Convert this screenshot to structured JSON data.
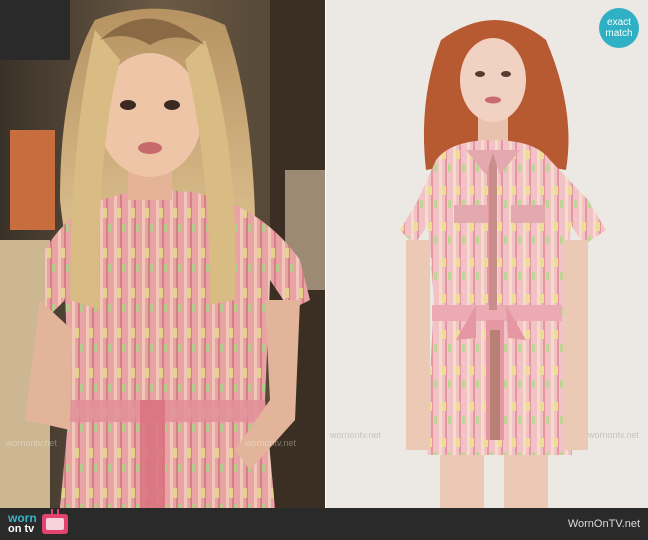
{
  "badge": {
    "line1": "exact",
    "line2": "match"
  },
  "watermarks": [
    "wornontv.net",
    "wornontv.net",
    "wornontv.net",
    "wornontv.net"
  ],
  "footer": {
    "logo_word1": "worn",
    "logo_word2": "on tv",
    "site_url": "WornOnTV.net"
  },
  "icons": {
    "logo_icon": "tv-icon"
  },
  "colors": {
    "badge": "#2fb0c5",
    "footer_bg": "#2a2a2a",
    "logo_accent": "#39b4c9",
    "tv_icon": "#e0446f"
  }
}
